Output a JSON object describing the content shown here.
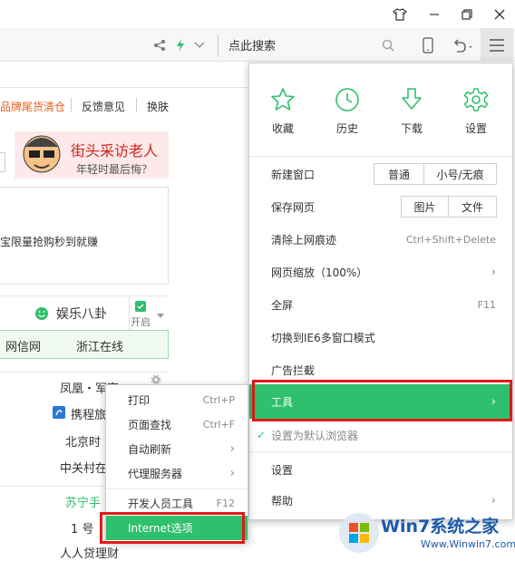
{
  "toolbar": {
    "search_placeholder": "点此搜索"
  },
  "page": {
    "nav_links": [
      "品牌尾货清仓",
      "反馈意见",
      "换肤"
    ],
    "ad_title": "街头采访老人",
    "ad_subtitle": "年轻时最后悔？",
    "promo_text": "宝限量抢购秒到就赚",
    "channel_label": "娱乐八卦",
    "channel_toggle": "开启",
    "green_links": [
      "网信网",
      "浙江在线"
    ],
    "list_items": [
      "凤凰・军事",
      "携程旅",
      "北京时",
      "中关村在",
      "苏宁手",
      "1 号",
      "人人贷理财"
    ]
  },
  "menu": {
    "quick": [
      {
        "label": "收藏",
        "icon": "star-icon"
      },
      {
        "label": "历史",
        "icon": "clock-icon"
      },
      {
        "label": "下载",
        "icon": "download-icon"
      },
      {
        "label": "设置",
        "icon": "gear-icon"
      }
    ],
    "new_window": "新建窗口",
    "new_window_normal": "普通",
    "new_window_private": "小号/无痕",
    "save_page": "保存网页",
    "save_image": "图片",
    "save_file": "文件",
    "clear_traces": "清除上网痕迹",
    "clear_shortcut": "Ctrl+Shift+Delete",
    "zoom": "网页缩放（100%）",
    "fullscreen": "全屏",
    "fullscreen_shortcut": "F11",
    "ie6_mode": "切换到IE6多窗口模式",
    "adblock": "广告拦截",
    "tools": "工具",
    "default_browser": "设置为默认浏览器",
    "settings": "设置",
    "help": "帮助"
  },
  "submenu": {
    "print": "打印",
    "print_shortcut": "Ctrl+P",
    "find": "页面查找",
    "find_shortcut": "Ctrl+F",
    "auto_refresh": "自动刷新",
    "proxy": "代理服务器",
    "devtools": "开发人员工具",
    "devtools_shortcut": "F12",
    "internet_options": "Internet选项"
  },
  "watermark": {
    "brand": "Win7系统之家",
    "url": "Www.Winwin7.com"
  },
  "colors": {
    "accent": "#2ec06c",
    "highlight_box": "#e01a1a",
    "close_button": "#e81123"
  }
}
